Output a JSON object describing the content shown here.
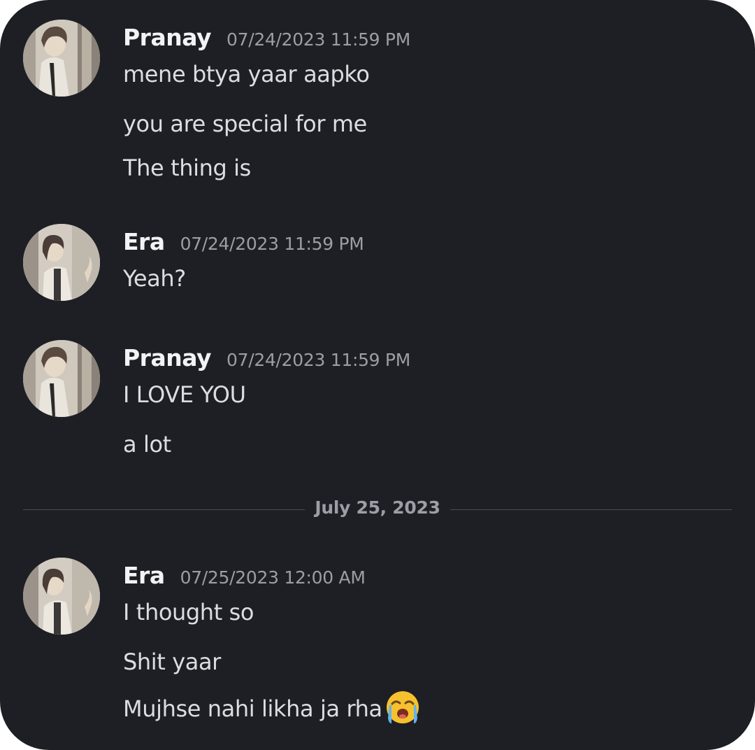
{
  "messages": [
    {
      "author": "Pranay",
      "avatar_icon": "avatar-boy-icon",
      "timestamp": "07/24/2023 11:59 PM",
      "lines": [
        "mene btya yaar aapko",
        "you are special for me",
        "The thing is"
      ]
    },
    {
      "author": "Era",
      "avatar_icon": "avatar-girl-icon",
      "timestamp": "07/24/2023 11:59 PM",
      "lines": [
        "Yeah?"
      ]
    },
    {
      "author": "Pranay",
      "avatar_icon": "avatar-boy-icon",
      "timestamp": "07/24/2023 11:59 PM",
      "lines": [
        "I LOVE YOU",
        "a lot"
      ]
    },
    {
      "author": "Era",
      "avatar_icon": "avatar-girl-icon",
      "timestamp": "07/25/2023 12:00 AM",
      "lines": [
        "I thought so",
        "Shit yaar",
        "Mujhse nahi likha ja rha"
      ],
      "last_line_emoji": "loudly-crying-face-emoji"
    }
  ],
  "date_divider": {
    "label": "July 25, 2023"
  },
  "colors": {
    "background": "#1e1f24",
    "username": "#f2f3f5",
    "timestamp": "#9b9ea6",
    "message_text": "#dcdde1",
    "divider": "#4b4d54"
  }
}
